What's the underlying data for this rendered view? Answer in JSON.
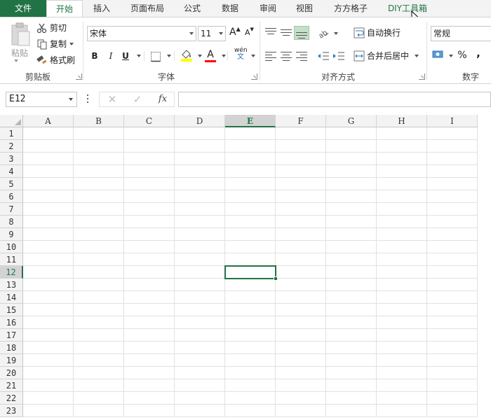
{
  "menu": {
    "file": "文件",
    "tabs": [
      "开始",
      "插入",
      "页面布局",
      "公式",
      "数据",
      "审阅",
      "视图",
      "方方格子",
      "DIY工具箱"
    ],
    "active_index": 0
  },
  "ribbon": {
    "clipboard": {
      "paste": "粘贴",
      "cut": "剪切",
      "copy": "复制",
      "format_painter": "格式刷",
      "label": "剪贴板"
    },
    "font": {
      "name": "宋体",
      "size": "11",
      "grow": "A",
      "shrink": "A",
      "bold": "B",
      "italic": "I",
      "underline": "U",
      "font_color_letter": "A",
      "phonetic_top": "wén",
      "phonetic_bottom": "文",
      "label": "字体",
      "fill_color": "#ffff00",
      "font_color": "#ff0000"
    },
    "alignment": {
      "wrap_text": "自动换行",
      "merge_center": "合并后居中",
      "label": "对齐方式"
    },
    "number": {
      "format": "常规",
      "percent": "%",
      "comma": ",",
      "label": "数字"
    }
  },
  "formula_bar": {
    "name_box": "E12",
    "cancel": "✕",
    "enter": "✓",
    "fx": "fx",
    "value": ""
  },
  "sheet": {
    "columns": [
      "A",
      "B",
      "C",
      "D",
      "E",
      "F",
      "G",
      "H",
      "I"
    ],
    "rows": [
      "1",
      "2",
      "3",
      "4",
      "5",
      "6",
      "7",
      "8",
      "9",
      "10",
      "11",
      "12",
      "13",
      "14",
      "15",
      "16",
      "17",
      "18",
      "19",
      "20",
      "21",
      "22",
      "23"
    ],
    "selected_column": "E",
    "selected_row": "12",
    "accent": "#217346"
  }
}
